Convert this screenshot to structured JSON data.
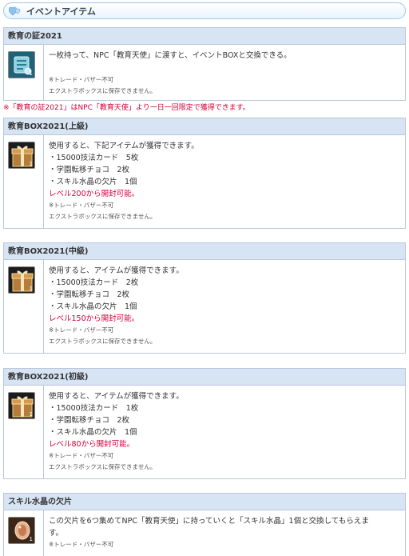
{
  "section": {
    "title": "イベントアイテム"
  },
  "note_between": "※「教育の証2021」はNPC「教育天使」より一日一回限定で獲得できます。",
  "items": [
    {
      "name": "教育の証2021",
      "icon": "scroll-icon",
      "qty": "1",
      "lines": [
        "一枚持って、NPC「教育天使」に渡すと、イベントBOXと交換できる。"
      ],
      "red": "",
      "notes": [
        "※トレード・バザー不可",
        "エクストラボックスに保存できません。"
      ]
    },
    {
      "name": "教育BOX2021(上級)",
      "icon": "gift-box-icon",
      "qty": "1",
      "lines": [
        "使用すると、下記アイテムが獲得できます。",
        "・15000技法カード　5枚",
        "・学園転移チョコ　2枚",
        "・スキル水晶の欠片　1個"
      ],
      "red": "レベル200から開封可能。",
      "notes": [
        "※トレード・バザー不可",
        "エクストラボックスに保存できません。"
      ]
    },
    {
      "name": "教育BOX2021(中級)",
      "icon": "gift-box-icon",
      "qty": "1",
      "lines": [
        "使用すると、アイテムが獲得できます。",
        "・15000技法カード　2枚",
        "・学園転移チョコ　2枚",
        "・スキル水晶の欠片　1個"
      ],
      "red": "レベル150から開封可能。",
      "notes": [
        "※トレード・バザー不可",
        "エクストラボックスに保存できません。"
      ]
    },
    {
      "name": "教育BOX2021(初級)",
      "icon": "gift-box-icon",
      "qty": "1",
      "lines": [
        "使用すると、アイテムが獲得できます。",
        "・15000技法カード　1枚",
        "・学園転移チョコ　2枚",
        "・スキル水晶の欠片　1個"
      ],
      "red": "レベル80から開封可能。",
      "notes": [
        "※トレード・バザー不可",
        "エクストラボックスに保存できません。"
      ]
    },
    {
      "name": "スキル水晶の欠片",
      "icon": "crystal-shard-icon",
      "qty": "1",
      "lines": [
        "この欠片を6つ集めてNPC「教育天使」に持っていくと「スキル水晶」1個と交換してもらえま",
        "す。"
      ],
      "red": "",
      "notes": [
        "※トレード・バザー不可"
      ]
    }
  ]
}
